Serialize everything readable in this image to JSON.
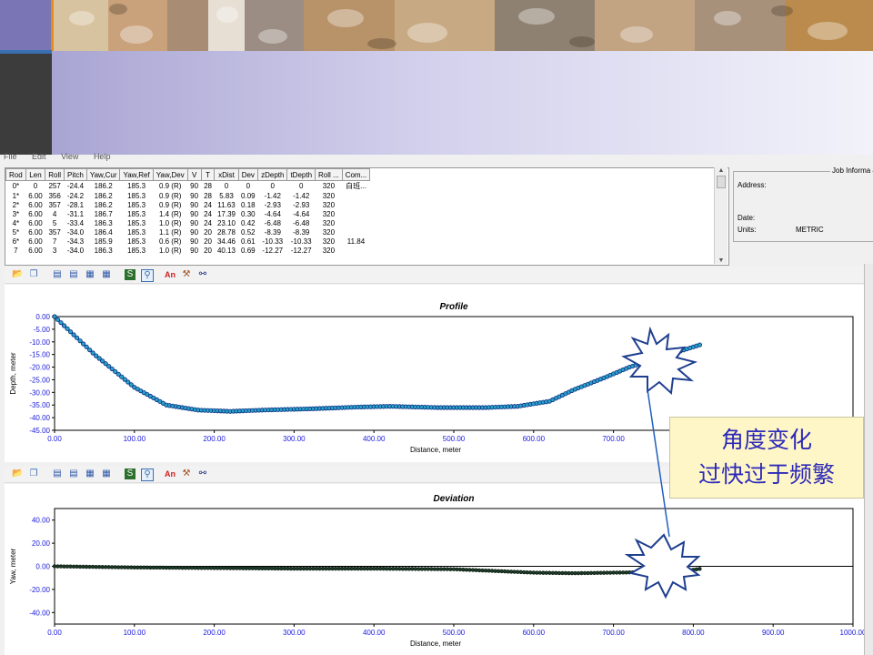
{
  "menu": [
    "File",
    "Edit",
    "View",
    "Help"
  ],
  "table": {
    "headers": [
      "Rod",
      "Len",
      "Roll",
      "Pitch",
      "Yaw,Cur",
      "Yaw,Ref",
      "Yaw,Dev",
      "V",
      "T",
      "xDist",
      "Dev",
      "zDepth",
      "tDepth",
      "Roll ...",
      "Com..."
    ],
    "rows": [
      [
        "0*",
        "0",
        "257",
        "-24.4",
        "186.2",
        "185.3",
        "0.9 (R)",
        "90",
        "28",
        "0",
        "0",
        "0",
        "0",
        "320",
        "白班..."
      ],
      [
        "1*",
        "6.00",
        "356",
        "-24.2",
        "186.2",
        "185.3",
        "0.9 (R)",
        "90",
        "28",
        "5.83",
        "0.09",
        "-1.42",
        "-1.42",
        "320",
        ""
      ],
      [
        "2*",
        "6.00",
        "357",
        "-28.1",
        "186.2",
        "185.3",
        "0.9 (R)",
        "90",
        "24",
        "11.63",
        "0.18",
        "-2.93",
        "-2.93",
        "320",
        ""
      ],
      [
        "3*",
        "6.00",
        "4",
        "-31.1",
        "186.7",
        "185.3",
        "1.4 (R)",
        "90",
        "24",
        "17.39",
        "0.30",
        "-4.64",
        "-4.64",
        "320",
        ""
      ],
      [
        "4*",
        "6.00",
        "5",
        "-33.4",
        "186.3",
        "185.3",
        "1.0 (R)",
        "90",
        "24",
        "23.10",
        "0.42",
        "-6.48",
        "-6.48",
        "320",
        ""
      ],
      [
        "5*",
        "6.00",
        "357",
        "-34.0",
        "186.4",
        "185.3",
        "1.1 (R)",
        "90",
        "20",
        "28.78",
        "0.52",
        "-8.39",
        "-8.39",
        "320",
        ""
      ],
      [
        "6*",
        "6.00",
        "7",
        "-34.3",
        "185.9",
        "185.3",
        "0.6 (R)",
        "90",
        "20",
        "34.46",
        "0.61",
        "-10.33",
        "-10.33",
        "320",
        "11.84"
      ],
      [
        "7",
        "6.00",
        "3",
        "-34.0",
        "186.3",
        "185.3",
        "1.0 (R)",
        "90",
        "20",
        "40.13",
        "0.69",
        "-12.27",
        "-12.27",
        "320",
        ""
      ]
    ]
  },
  "job": {
    "title": "Job Informa",
    "address_label": "Address:",
    "date_label": "Date:",
    "units_label": "Units:",
    "units_value": "METRIC"
  },
  "callout": {
    "line1": "角度变化",
    "line2": "过快过于频繁"
  },
  "colors": {
    "profile_line": "#1c2fd0",
    "profile_marker": "#2aa2c8",
    "deviation_marker": "#1e3d2a",
    "axis_tick": "#1a1adc"
  },
  "chart_data": [
    {
      "type": "scatter",
      "title": "Profile",
      "xlabel": "Distance, meter",
      "ylabel": "Depth, meter",
      "xlim": [
        0,
        1000
      ],
      "ylim": [
        -45,
        0
      ],
      "xticks": [
        "0.00",
        "100.00",
        "200.00",
        "300.00",
        "400.00",
        "500.00",
        "600.00",
        "700.00"
      ],
      "yticks": [
        "0.00",
        "-5.00",
        "-10.00",
        "-15.00",
        "-20.00",
        "-25.00",
        "-30.00",
        "-35.00",
        "-40.00",
        "-45.00"
      ],
      "x": [
        0,
        50,
        100,
        140,
        180,
        220,
        260,
        320,
        380,
        420,
        480,
        540,
        580,
        620,
        650,
        690,
        720,
        760,
        790,
        810
      ],
      "y": [
        0,
        -15,
        -28,
        -35,
        -37,
        -37.5,
        -37,
        -36.5,
        -35.8,
        -35.5,
        -36,
        -36,
        -35.5,
        -33.5,
        -29,
        -24,
        -20,
        -16,
        -13,
        -11
      ],
      "grid": false
    },
    {
      "type": "scatter",
      "title": "Deviation",
      "xlabel": "Distance, meter",
      "ylabel": "Yaw, meter",
      "xlim": [
        0,
        1000
      ],
      "ylim": [
        -50,
        50
      ],
      "xticks": [
        "0.00",
        "100.00",
        "200.00",
        "300.00",
        "400.00",
        "500.00",
        "600.00",
        "700.00",
        "800.00",
        "900.00",
        "1000.00"
      ],
      "yticks": [
        "40.00",
        "20.00",
        "0.00",
        "-20.00",
        "-40.00"
      ],
      "x": [
        0,
        100,
        200,
        300,
        400,
        500,
        550,
        600,
        650,
        700,
        750,
        800,
        810
      ],
      "y": [
        0,
        -1,
        -1.5,
        -2,
        -2,
        -2.5,
        -4,
        -5.5,
        -6,
        -5.5,
        -5,
        -3,
        -2
      ],
      "grid": false
    }
  ]
}
